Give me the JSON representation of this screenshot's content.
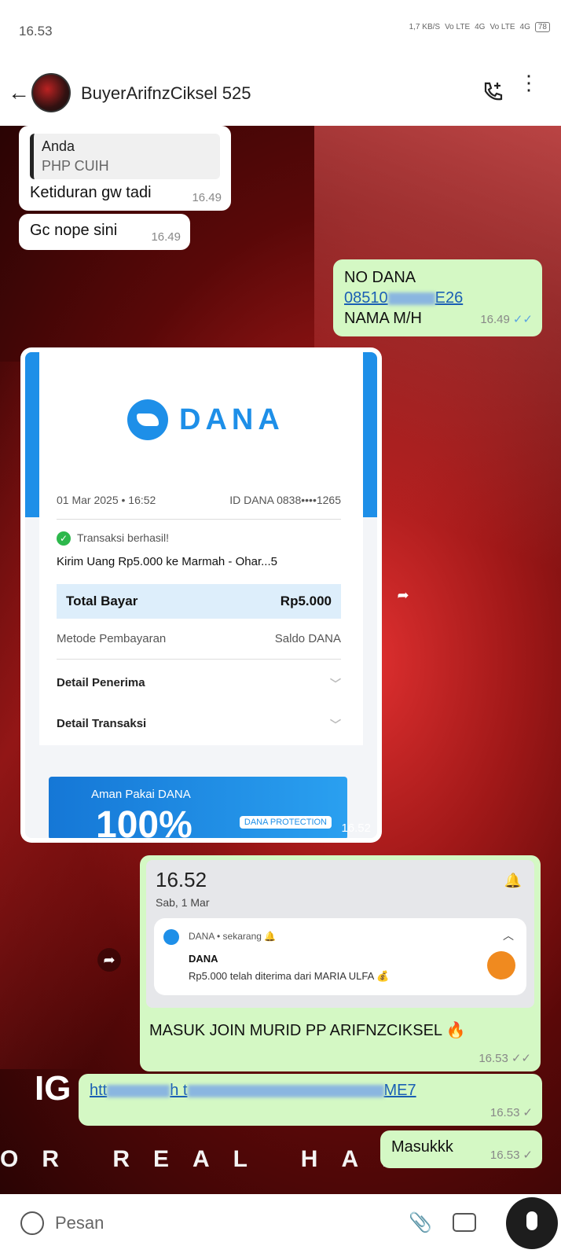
{
  "status_bar": {
    "time": "16.53",
    "network": "1,7 KB/S",
    "lte1": "Vo LTE",
    "sig1": "4G",
    "lte2": "Vo LTE",
    "sig2": "4G",
    "battery": "78"
  },
  "header": {
    "contact_name": "BuyerArifnzCiksel 525"
  },
  "messages": {
    "m1": {
      "quote_name": "Anda",
      "quote_text": "PHP CUIH",
      "text": "Ketiduran gw tadi",
      "time": "16.49"
    },
    "m2": {
      "text": "Gc nope sini",
      "time": "16.49"
    },
    "m3": {
      "line1": "NO DANA",
      "line2_visible_start": "08510",
      "line2_visible_end": "E26",
      "line3": "NAMA M/H",
      "time": "16.49",
      "ticks": "✓✓"
    },
    "m4": {
      "time": "16.52",
      "receipt": {
        "brand": "DANA",
        "date": "01 Mar 2025 • 16:52",
        "id_dana": "ID DANA 0838••••1265",
        "status": "Transaksi berhasil!",
        "description": "Kirim Uang Rp5.000 ke Marmah - Ohar...5",
        "total_label": "Total Bayar",
        "total_value": "Rp5.000",
        "method_label": "Metode Pembayaran",
        "method_value": "Saldo DANA",
        "recipient_label": "Detail Penerima",
        "transaction_label": "Detail Transaksi",
        "promo_text": "Aman Pakai DANA",
        "promo_big": "100%",
        "promo_tag": "DANA PROTECTION"
      }
    },
    "m5": {
      "notif_clock": "16.52",
      "notif_date": "Sab, 1 Mar",
      "notif_source": "DANA • sekarang 🔔",
      "notif_title": "DANA",
      "notif_body": "Rp5.000 telah diterima dari MARIA ULFA 💰",
      "caption": "MASUK JOIN MURID PP ARIFNZCIKSEL 🔥",
      "time": "16.53",
      "ticks": "✓✓"
    },
    "m6": {
      "link_start": "htt",
      "link_mid": "h t",
      "link_end": "ME7",
      "time": "16.53",
      "ticks": "✓"
    },
    "m7": {
      "text": "Masukkk",
      "time": "16.53",
      "ticks": "✓"
    }
  },
  "background": {
    "ig_text": "IG",
    "banner_text": "OR REAL HANY"
  },
  "input": {
    "placeholder": "Pesan"
  },
  "colors": {
    "accent_blue": "#1e8fe8",
    "out_bubble": "#d4f8c4",
    "read_ticks": "#5aa3e0"
  }
}
